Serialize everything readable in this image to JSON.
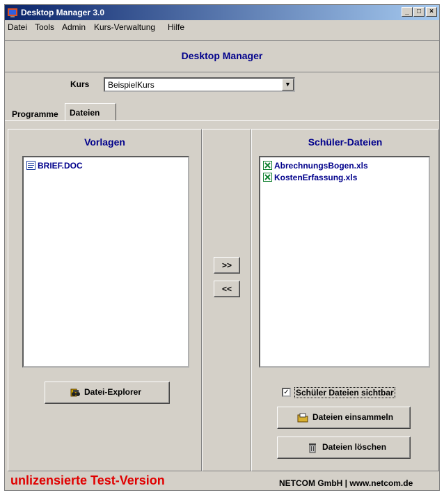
{
  "window": {
    "title": "Desktop Manager 3.0",
    "min_glyph": "_",
    "max_glyph": "□",
    "close_glyph": "×"
  },
  "menu": [
    "Datei",
    "Tools",
    "Admin",
    "Kurs-Verwaltung",
    "Hilfe"
  ],
  "header": {
    "title": "Desktop Manager"
  },
  "kurs": {
    "label": "Kurs",
    "value": "BeispielKurs"
  },
  "tabs": [
    {
      "label": "Programme"
    },
    {
      "label": "Dateien",
      "active": true
    }
  ],
  "vorlagen": {
    "title": "Vorlagen",
    "files": [
      {
        "name": "BRIEF.DOC",
        "icon": "word-doc-icon"
      }
    ]
  },
  "transfer": {
    "to_right": ">>",
    "to_left": "<<"
  },
  "schueler": {
    "title": "Schüler-Dateien",
    "files": [
      {
        "name": "AbrechnungsBogen.xls",
        "icon": "excel-icon"
      },
      {
        "name": "KostenErfassung.xls",
        "icon": "excel-icon"
      }
    ],
    "visible_checkbox": {
      "label": "Schüler Dateien sichtbar",
      "checked": true
    }
  },
  "buttons": {
    "explorer": "Datei-Explorer",
    "collect": "Dateien einsammeln",
    "delete": "Dateien löschen"
  },
  "footer": {
    "warning": "unlizensierte Test-Version",
    "company": "NETCOM GmbH | www.netcom.de"
  },
  "colors": {
    "accent_blue": "#00008b",
    "warning_red": "#e00000",
    "face": "#d4d0c8"
  }
}
